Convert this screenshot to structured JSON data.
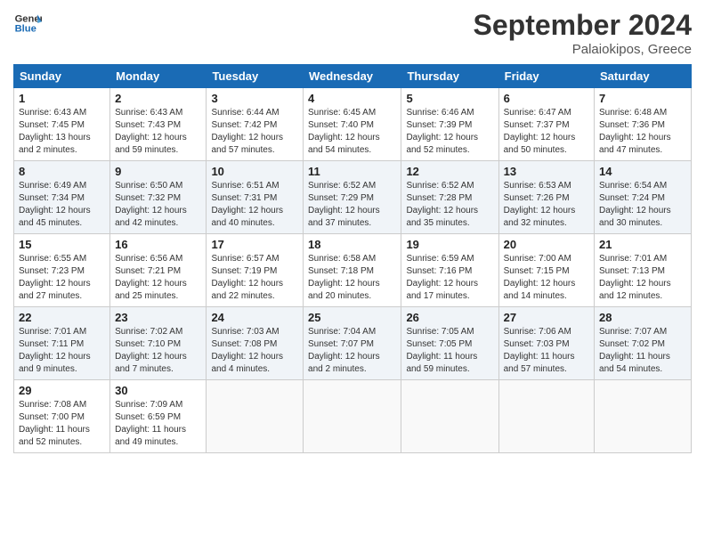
{
  "header": {
    "logo_line1": "General",
    "logo_line2": "Blue",
    "month": "September 2024",
    "location": "Palaiokipos, Greece"
  },
  "weekdays": [
    "Sunday",
    "Monday",
    "Tuesday",
    "Wednesday",
    "Thursday",
    "Friday",
    "Saturday"
  ],
  "weeks": [
    [
      {
        "day": "1",
        "info": "Sunrise: 6:43 AM\nSunset: 7:45 PM\nDaylight: 13 hours\nand 2 minutes."
      },
      {
        "day": "2",
        "info": "Sunrise: 6:43 AM\nSunset: 7:43 PM\nDaylight: 12 hours\nand 59 minutes."
      },
      {
        "day": "3",
        "info": "Sunrise: 6:44 AM\nSunset: 7:42 PM\nDaylight: 12 hours\nand 57 minutes."
      },
      {
        "day": "4",
        "info": "Sunrise: 6:45 AM\nSunset: 7:40 PM\nDaylight: 12 hours\nand 54 minutes."
      },
      {
        "day": "5",
        "info": "Sunrise: 6:46 AM\nSunset: 7:39 PM\nDaylight: 12 hours\nand 52 minutes."
      },
      {
        "day": "6",
        "info": "Sunrise: 6:47 AM\nSunset: 7:37 PM\nDaylight: 12 hours\nand 50 minutes."
      },
      {
        "day": "7",
        "info": "Sunrise: 6:48 AM\nSunset: 7:36 PM\nDaylight: 12 hours\nand 47 minutes."
      }
    ],
    [
      {
        "day": "8",
        "info": "Sunrise: 6:49 AM\nSunset: 7:34 PM\nDaylight: 12 hours\nand 45 minutes."
      },
      {
        "day": "9",
        "info": "Sunrise: 6:50 AM\nSunset: 7:32 PM\nDaylight: 12 hours\nand 42 minutes."
      },
      {
        "day": "10",
        "info": "Sunrise: 6:51 AM\nSunset: 7:31 PM\nDaylight: 12 hours\nand 40 minutes."
      },
      {
        "day": "11",
        "info": "Sunrise: 6:52 AM\nSunset: 7:29 PM\nDaylight: 12 hours\nand 37 minutes."
      },
      {
        "day": "12",
        "info": "Sunrise: 6:52 AM\nSunset: 7:28 PM\nDaylight: 12 hours\nand 35 minutes."
      },
      {
        "day": "13",
        "info": "Sunrise: 6:53 AM\nSunset: 7:26 PM\nDaylight: 12 hours\nand 32 minutes."
      },
      {
        "day": "14",
        "info": "Sunrise: 6:54 AM\nSunset: 7:24 PM\nDaylight: 12 hours\nand 30 minutes."
      }
    ],
    [
      {
        "day": "15",
        "info": "Sunrise: 6:55 AM\nSunset: 7:23 PM\nDaylight: 12 hours\nand 27 minutes."
      },
      {
        "day": "16",
        "info": "Sunrise: 6:56 AM\nSunset: 7:21 PM\nDaylight: 12 hours\nand 25 minutes."
      },
      {
        "day": "17",
        "info": "Sunrise: 6:57 AM\nSunset: 7:19 PM\nDaylight: 12 hours\nand 22 minutes."
      },
      {
        "day": "18",
        "info": "Sunrise: 6:58 AM\nSunset: 7:18 PM\nDaylight: 12 hours\nand 20 minutes."
      },
      {
        "day": "19",
        "info": "Sunrise: 6:59 AM\nSunset: 7:16 PM\nDaylight: 12 hours\nand 17 minutes."
      },
      {
        "day": "20",
        "info": "Sunrise: 7:00 AM\nSunset: 7:15 PM\nDaylight: 12 hours\nand 14 minutes."
      },
      {
        "day": "21",
        "info": "Sunrise: 7:01 AM\nSunset: 7:13 PM\nDaylight: 12 hours\nand 12 minutes."
      }
    ],
    [
      {
        "day": "22",
        "info": "Sunrise: 7:01 AM\nSunset: 7:11 PM\nDaylight: 12 hours\nand 9 minutes."
      },
      {
        "day": "23",
        "info": "Sunrise: 7:02 AM\nSunset: 7:10 PM\nDaylight: 12 hours\nand 7 minutes."
      },
      {
        "day": "24",
        "info": "Sunrise: 7:03 AM\nSunset: 7:08 PM\nDaylight: 12 hours\nand 4 minutes."
      },
      {
        "day": "25",
        "info": "Sunrise: 7:04 AM\nSunset: 7:07 PM\nDaylight: 12 hours\nand 2 minutes."
      },
      {
        "day": "26",
        "info": "Sunrise: 7:05 AM\nSunset: 7:05 PM\nDaylight: 11 hours\nand 59 minutes."
      },
      {
        "day": "27",
        "info": "Sunrise: 7:06 AM\nSunset: 7:03 PM\nDaylight: 11 hours\nand 57 minutes."
      },
      {
        "day": "28",
        "info": "Sunrise: 7:07 AM\nSunset: 7:02 PM\nDaylight: 11 hours\nand 54 minutes."
      }
    ],
    [
      {
        "day": "29",
        "info": "Sunrise: 7:08 AM\nSunset: 7:00 PM\nDaylight: 11 hours\nand 52 minutes."
      },
      {
        "day": "30",
        "info": "Sunrise: 7:09 AM\nSunset: 6:59 PM\nDaylight: 11 hours\nand 49 minutes."
      },
      {
        "day": "",
        "info": ""
      },
      {
        "day": "",
        "info": ""
      },
      {
        "day": "",
        "info": ""
      },
      {
        "day": "",
        "info": ""
      },
      {
        "day": "",
        "info": ""
      }
    ]
  ]
}
